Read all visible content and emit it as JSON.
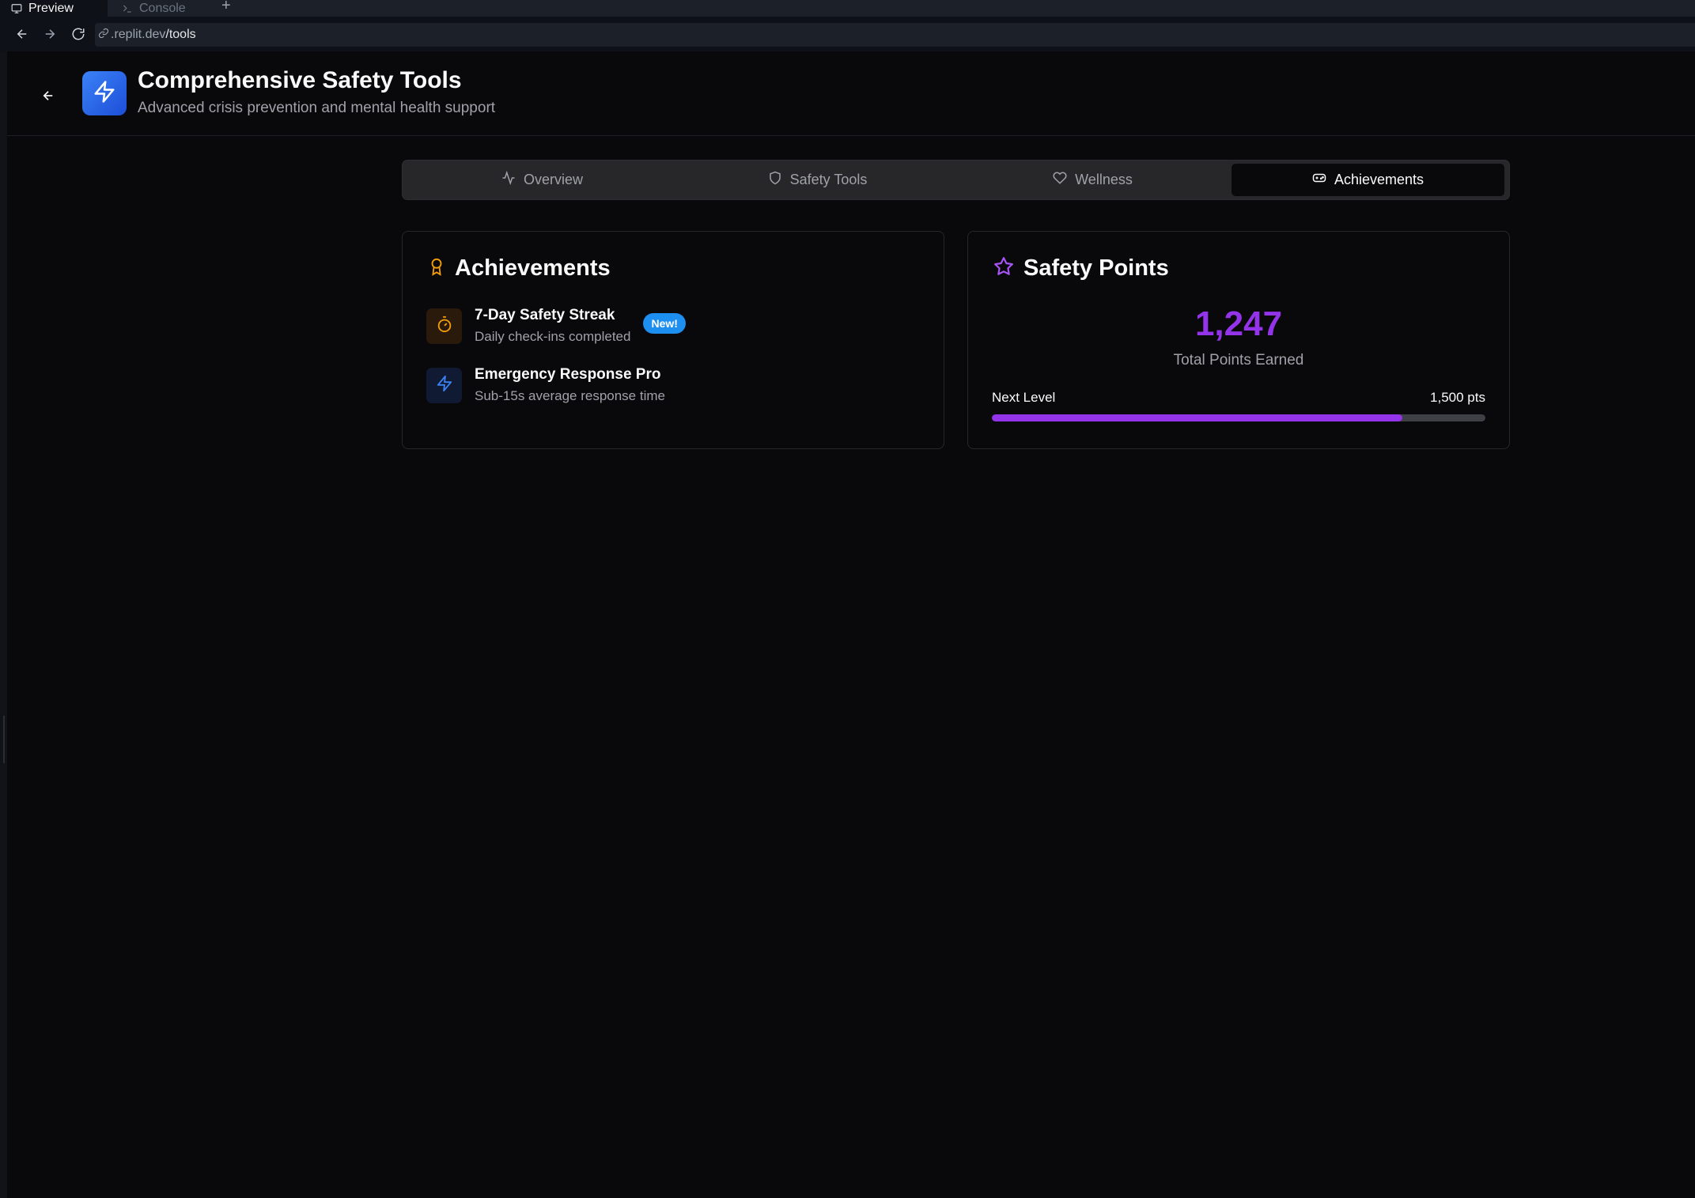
{
  "browser": {
    "tabs": [
      {
        "label": "Preview",
        "icon": "monitor-icon"
      },
      {
        "label": "Console",
        "icon": "terminal-icon"
      }
    ],
    "add_tab": "+",
    "url_host": ".replit.dev",
    "url_path": "/tools"
  },
  "header": {
    "title": "Comprehensive Safety Tools",
    "subtitle": "Advanced crisis prevention and mental health support",
    "logo_icon": "lightning-icon"
  },
  "tabs": [
    {
      "label": "Overview",
      "icon": "activity-icon",
      "active": false
    },
    {
      "label": "Safety Tools",
      "icon": "shield-icon",
      "active": false
    },
    {
      "label": "Wellness",
      "icon": "heart-icon",
      "active": false
    },
    {
      "label": "Achievements",
      "icon": "gamepad-icon",
      "active": true
    }
  ],
  "achievements": {
    "title": "Achievements",
    "icon": "award-icon",
    "icon_color": "#f59e0b",
    "items": [
      {
        "name": "7-Day Safety Streak",
        "desc": "Daily check-ins completed",
        "badge": "New!",
        "icon": "timer-icon",
        "color": "#f59e0b"
      },
      {
        "name": "Emergency Response Pro",
        "desc": "Sub-15s average response time",
        "icon": "lightning-icon",
        "color": "#3b82f6"
      }
    ]
  },
  "points": {
    "title": "Safety Points",
    "icon": "star-icon",
    "icon_color": "#a855f7",
    "value": "1,247",
    "label": "Total Points Earned",
    "next_label": "Next Level",
    "next_target": "1,500 pts",
    "progress_fraction": 0.831,
    "accent": "#9333ea"
  }
}
